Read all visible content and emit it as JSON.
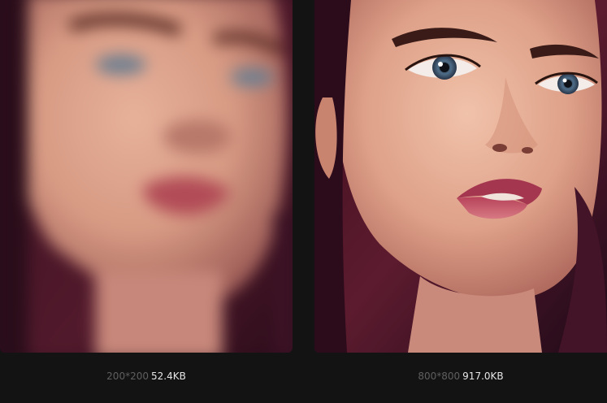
{
  "comparison": {
    "original": {
      "dimensions": "200*200",
      "file_size": "52.4KB",
      "image_icon": "portrait-photo-blurred"
    },
    "enhanced": {
      "dimensions": "800*800",
      "file_size": "917.0KB",
      "image_icon": "portrait-photo-sharp"
    }
  },
  "colors": {
    "background": "#131313",
    "dimension_text": "#5f5f5f",
    "size_text": "#e6e6e6"
  }
}
